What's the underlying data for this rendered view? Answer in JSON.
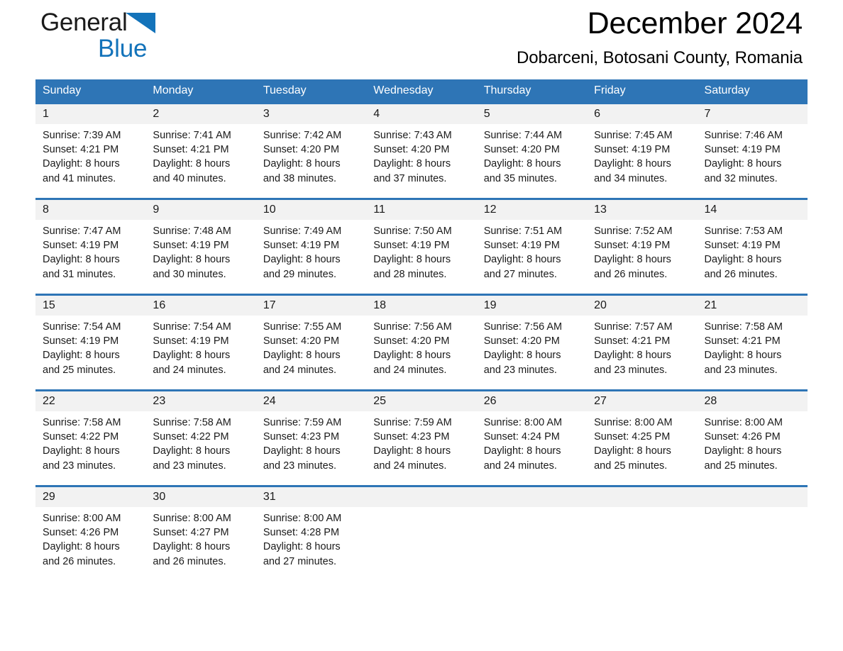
{
  "brand": {
    "word1": "General",
    "word2": "Blue",
    "triangle_color": "#1373ba",
    "text_color": "#1a1a1a"
  },
  "header": {
    "month_title": "December 2024",
    "location": "Dobarceni, Botosani County, Romania"
  },
  "theme": {
    "header_blue": "#2e75b6",
    "rule_blue": "#2e75b6",
    "date_band_gray": "#f2f2f2",
    "text": "#1a1a1a",
    "page_background": "#ffffff"
  },
  "calendar": {
    "day_headers": [
      "Sunday",
      "Monday",
      "Tuesday",
      "Wednesday",
      "Thursday",
      "Friday",
      "Saturday"
    ],
    "weeks": [
      {
        "days": [
          {
            "date": "1",
            "sunrise": "Sunrise: 7:39 AM",
            "sunset": "Sunset: 4:21 PM",
            "daylight_l1": "Daylight: 8 hours",
            "daylight_l2": "and 41 minutes."
          },
          {
            "date": "2",
            "sunrise": "Sunrise: 7:41 AM",
            "sunset": "Sunset: 4:21 PM",
            "daylight_l1": "Daylight: 8 hours",
            "daylight_l2": "and 40 minutes."
          },
          {
            "date": "3",
            "sunrise": "Sunrise: 7:42 AM",
            "sunset": "Sunset: 4:20 PM",
            "daylight_l1": "Daylight: 8 hours",
            "daylight_l2": "and 38 minutes."
          },
          {
            "date": "4",
            "sunrise": "Sunrise: 7:43 AM",
            "sunset": "Sunset: 4:20 PM",
            "daylight_l1": "Daylight: 8 hours",
            "daylight_l2": "and 37 minutes."
          },
          {
            "date": "5",
            "sunrise": "Sunrise: 7:44 AM",
            "sunset": "Sunset: 4:20 PM",
            "daylight_l1": "Daylight: 8 hours",
            "daylight_l2": "and 35 minutes."
          },
          {
            "date": "6",
            "sunrise": "Sunrise: 7:45 AM",
            "sunset": "Sunset: 4:19 PM",
            "daylight_l1": "Daylight: 8 hours",
            "daylight_l2": "and 34 minutes."
          },
          {
            "date": "7",
            "sunrise": "Sunrise: 7:46 AM",
            "sunset": "Sunset: 4:19 PM",
            "daylight_l1": "Daylight: 8 hours",
            "daylight_l2": "and 32 minutes."
          }
        ]
      },
      {
        "days": [
          {
            "date": "8",
            "sunrise": "Sunrise: 7:47 AM",
            "sunset": "Sunset: 4:19 PM",
            "daylight_l1": "Daylight: 8 hours",
            "daylight_l2": "and 31 minutes."
          },
          {
            "date": "9",
            "sunrise": "Sunrise: 7:48 AM",
            "sunset": "Sunset: 4:19 PM",
            "daylight_l1": "Daylight: 8 hours",
            "daylight_l2": "and 30 minutes."
          },
          {
            "date": "10",
            "sunrise": "Sunrise: 7:49 AM",
            "sunset": "Sunset: 4:19 PM",
            "daylight_l1": "Daylight: 8 hours",
            "daylight_l2": "and 29 minutes."
          },
          {
            "date": "11",
            "sunrise": "Sunrise: 7:50 AM",
            "sunset": "Sunset: 4:19 PM",
            "daylight_l1": "Daylight: 8 hours",
            "daylight_l2": "and 28 minutes."
          },
          {
            "date": "12",
            "sunrise": "Sunrise: 7:51 AM",
            "sunset": "Sunset: 4:19 PM",
            "daylight_l1": "Daylight: 8 hours",
            "daylight_l2": "and 27 minutes."
          },
          {
            "date": "13",
            "sunrise": "Sunrise: 7:52 AM",
            "sunset": "Sunset: 4:19 PM",
            "daylight_l1": "Daylight: 8 hours",
            "daylight_l2": "and 26 minutes."
          },
          {
            "date": "14",
            "sunrise": "Sunrise: 7:53 AM",
            "sunset": "Sunset: 4:19 PM",
            "daylight_l1": "Daylight: 8 hours",
            "daylight_l2": "and 26 minutes."
          }
        ]
      },
      {
        "days": [
          {
            "date": "15",
            "sunrise": "Sunrise: 7:54 AM",
            "sunset": "Sunset: 4:19 PM",
            "daylight_l1": "Daylight: 8 hours",
            "daylight_l2": "and 25 minutes."
          },
          {
            "date": "16",
            "sunrise": "Sunrise: 7:54 AM",
            "sunset": "Sunset: 4:19 PM",
            "daylight_l1": "Daylight: 8 hours",
            "daylight_l2": "and 24 minutes."
          },
          {
            "date": "17",
            "sunrise": "Sunrise: 7:55 AM",
            "sunset": "Sunset: 4:20 PM",
            "daylight_l1": "Daylight: 8 hours",
            "daylight_l2": "and 24 minutes."
          },
          {
            "date": "18",
            "sunrise": "Sunrise: 7:56 AM",
            "sunset": "Sunset: 4:20 PM",
            "daylight_l1": "Daylight: 8 hours",
            "daylight_l2": "and 24 minutes."
          },
          {
            "date": "19",
            "sunrise": "Sunrise: 7:56 AM",
            "sunset": "Sunset: 4:20 PM",
            "daylight_l1": "Daylight: 8 hours",
            "daylight_l2": "and 23 minutes."
          },
          {
            "date": "20",
            "sunrise": "Sunrise: 7:57 AM",
            "sunset": "Sunset: 4:21 PM",
            "daylight_l1": "Daylight: 8 hours",
            "daylight_l2": "and 23 minutes."
          },
          {
            "date": "21",
            "sunrise": "Sunrise: 7:58 AM",
            "sunset": "Sunset: 4:21 PM",
            "daylight_l1": "Daylight: 8 hours",
            "daylight_l2": "and 23 minutes."
          }
        ]
      },
      {
        "days": [
          {
            "date": "22",
            "sunrise": "Sunrise: 7:58 AM",
            "sunset": "Sunset: 4:22 PM",
            "daylight_l1": "Daylight: 8 hours",
            "daylight_l2": "and 23 minutes."
          },
          {
            "date": "23",
            "sunrise": "Sunrise: 7:58 AM",
            "sunset": "Sunset: 4:22 PM",
            "daylight_l1": "Daylight: 8 hours",
            "daylight_l2": "and 23 minutes."
          },
          {
            "date": "24",
            "sunrise": "Sunrise: 7:59 AM",
            "sunset": "Sunset: 4:23 PM",
            "daylight_l1": "Daylight: 8 hours",
            "daylight_l2": "and 23 minutes."
          },
          {
            "date": "25",
            "sunrise": "Sunrise: 7:59 AM",
            "sunset": "Sunset: 4:23 PM",
            "daylight_l1": "Daylight: 8 hours",
            "daylight_l2": "and 24 minutes."
          },
          {
            "date": "26",
            "sunrise": "Sunrise: 8:00 AM",
            "sunset": "Sunset: 4:24 PM",
            "daylight_l1": "Daylight: 8 hours",
            "daylight_l2": "and 24 minutes."
          },
          {
            "date": "27",
            "sunrise": "Sunrise: 8:00 AM",
            "sunset": "Sunset: 4:25 PM",
            "daylight_l1": "Daylight: 8 hours",
            "daylight_l2": "and 25 minutes."
          },
          {
            "date": "28",
            "sunrise": "Sunrise: 8:00 AM",
            "sunset": "Sunset: 4:26 PM",
            "daylight_l1": "Daylight: 8 hours",
            "daylight_l2": "and 25 minutes."
          }
        ]
      },
      {
        "days": [
          {
            "date": "29",
            "sunrise": "Sunrise: 8:00 AM",
            "sunset": "Sunset: 4:26 PM",
            "daylight_l1": "Daylight: 8 hours",
            "daylight_l2": "and 26 minutes."
          },
          {
            "date": "30",
            "sunrise": "Sunrise: 8:00 AM",
            "sunset": "Sunset: 4:27 PM",
            "daylight_l1": "Daylight: 8 hours",
            "daylight_l2": "and 26 minutes."
          },
          {
            "date": "31",
            "sunrise": "Sunrise: 8:00 AM",
            "sunset": "Sunset: 4:28 PM",
            "daylight_l1": "Daylight: 8 hours",
            "daylight_l2": "and 27 minutes."
          },
          {
            "date": "",
            "sunrise": "",
            "sunset": "",
            "daylight_l1": "",
            "daylight_l2": ""
          },
          {
            "date": "",
            "sunrise": "",
            "sunset": "",
            "daylight_l1": "",
            "daylight_l2": ""
          },
          {
            "date": "",
            "sunrise": "",
            "sunset": "",
            "daylight_l1": "",
            "daylight_l2": ""
          },
          {
            "date": "",
            "sunrise": "",
            "sunset": "",
            "daylight_l1": "",
            "daylight_l2": ""
          }
        ]
      }
    ]
  }
}
